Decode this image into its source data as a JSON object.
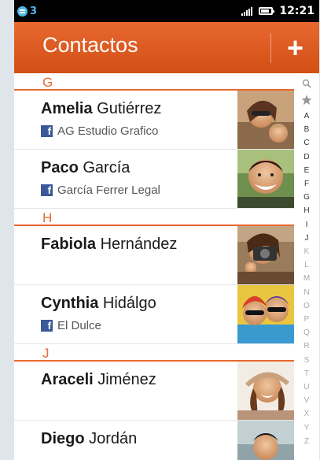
{
  "status_bar": {
    "notification_count": "3",
    "time": "12:21",
    "battery_level": 0.8
  },
  "header": {
    "title": "Contactos",
    "add_label": "+"
  },
  "sections": [
    {
      "letter": "G",
      "contacts": [
        {
          "first": "Amelia",
          "last": "Gutiérrez",
          "org": "AG Estudio Grafico"
        },
        {
          "first": "Paco",
          "last": "García",
          "org": "García Ferrer Legal"
        }
      ]
    },
    {
      "letter": "H",
      "contacts": [
        {
          "first": "Fabiola",
          "last": "Hernández",
          "org": ""
        },
        {
          "first": "Cynthia",
          "last": "Hidálgo",
          "org": "El Dulce"
        }
      ]
    },
    {
      "letter": "J",
      "contacts": [
        {
          "first": "Araceli",
          "last": "Jiménez",
          "org": ""
        },
        {
          "first": "Diego",
          "last": "Jordán",
          "org": ""
        }
      ]
    }
  ],
  "index_bar": {
    "icons": [
      "search-icon",
      "favorites-star-icon"
    ],
    "letters": [
      "A",
      "B",
      "C",
      "D",
      "E",
      "F",
      "G",
      "H",
      "I",
      "J",
      "K",
      "L",
      "M",
      "N",
      "O",
      "P",
      "Q",
      "R",
      "S",
      "T",
      "U",
      "V",
      "X",
      "Y",
      "Z"
    ],
    "active_letters": [
      "A",
      "B",
      "C",
      "D",
      "E",
      "F",
      "G",
      "H",
      "I",
      "J"
    ]
  },
  "colors": {
    "accent": "#e8682f",
    "header_dark": "#d24f15",
    "facebook": "#3b5998",
    "status_icon": "#4fb8e6"
  }
}
